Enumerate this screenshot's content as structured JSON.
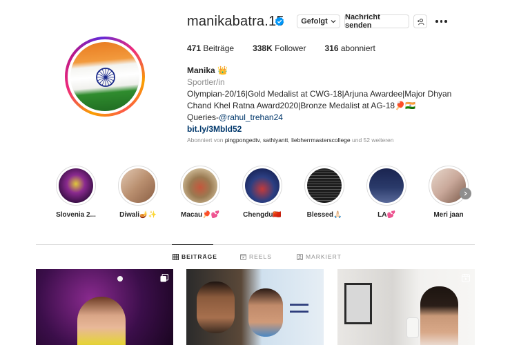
{
  "profile": {
    "username": "manikabatra.15",
    "buttons": {
      "following": "Gefolgt",
      "message": "Nachricht senden"
    },
    "stats": {
      "posts_count": "471",
      "posts_label": "Beiträge",
      "followers_count": "338K",
      "followers_label": "Follower",
      "following_count": "316",
      "following_label": "abonniert"
    },
    "bio": {
      "name": "Manika 👑",
      "category": "Sportler/in",
      "line1": "Olympian-20/16|Gold Medalist at CWG-18|Arjuna Awardee|Major Dhyan Chand Khel Ratna Award2020|Bronze Medalist at AG-18🏓🇮🇳",
      "queries_prefix": "Queries-",
      "queries_mention": "@rahul_trehan24",
      "link": "bit.ly/3Mbld52"
    },
    "followed_by": {
      "prefix": "Abonniert von",
      "user1": "pingpongedtv",
      "user2": "sathiyantt",
      "user3": "liebherrmasterscollege",
      "suffix": "und 52 weiteren"
    }
  },
  "highlights": [
    {
      "label": "Slovenia 2...",
      "color": "#5b1c6e"
    },
    {
      "label": "Diwali🪔✨",
      "color": "#b98f6f"
    },
    {
      "label": "Macau🏓💕",
      "color": "#9a7a52"
    },
    {
      "label": "Chengdu🇨🇳",
      "color": "#2c3f82"
    },
    {
      "label": "Blessed🙏🏻",
      "color": "#1c1c1c"
    },
    {
      "label": "LA💕",
      "color": "#2a3a6a"
    },
    {
      "label": "Meri jaan",
      "color": "#c9a89a"
    }
  ],
  "tabs": {
    "posts": "BEITRÄGE",
    "reels": "REELS",
    "tagged": "MARKIERT"
  },
  "colors": {
    "accent_blue": "#0095f6",
    "link_blue": "#00376b",
    "text": "#262626",
    "muted": "#8e8e8e",
    "border": "#dbdbdb"
  }
}
